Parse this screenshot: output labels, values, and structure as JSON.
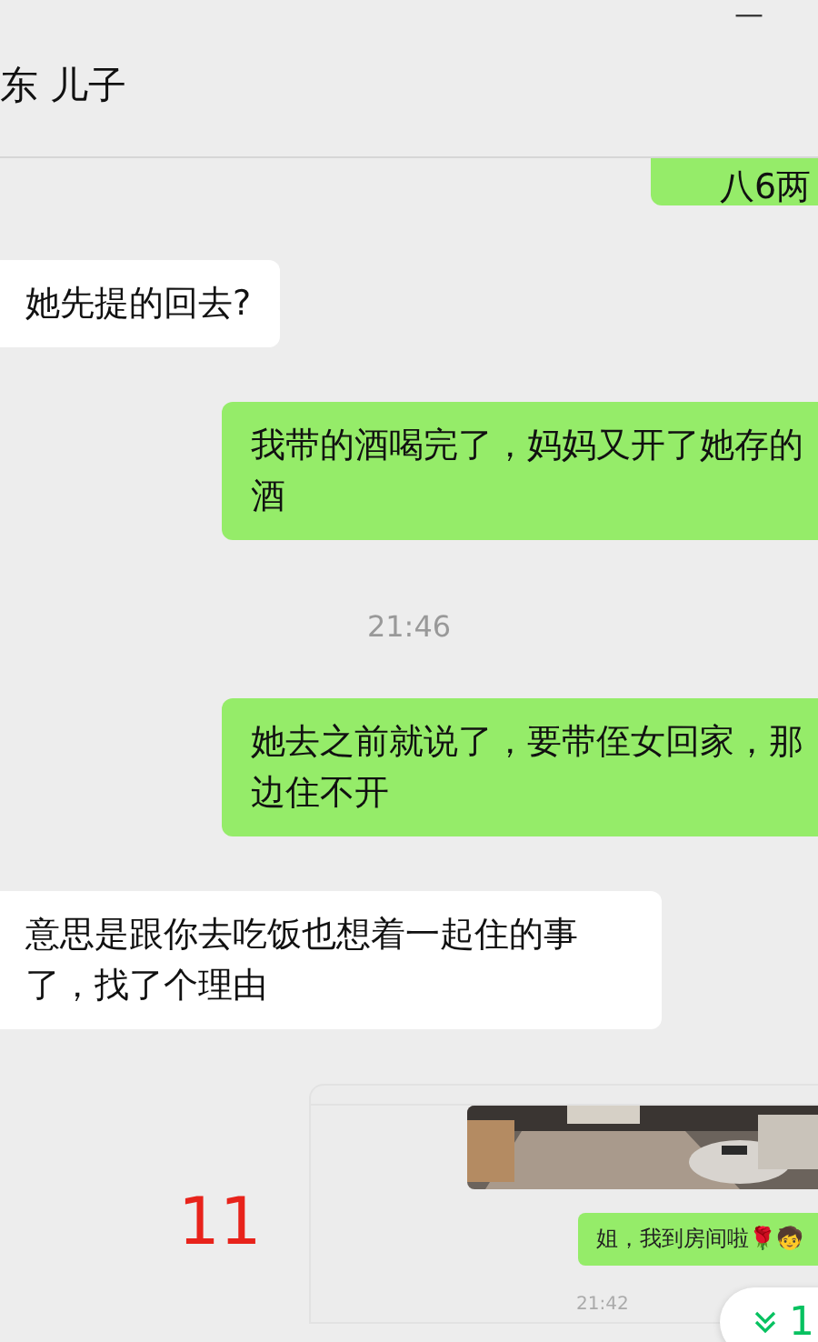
{
  "window": {
    "minimize": "—"
  },
  "header": {
    "title": "东 儿子"
  },
  "messages": [
    {
      "kind": "sent",
      "text": "八6两"
    },
    {
      "kind": "received",
      "text": "她先提的回去?"
    },
    {
      "kind": "sent",
      "text": "我带的酒喝完了，妈妈又开了她存的酒"
    },
    {
      "kind": "time",
      "text": "21:46"
    },
    {
      "kind": "sent",
      "text": "她去之前就说了，要带侄女回家，那边住不开"
    },
    {
      "kind": "received",
      "text": "意思是跟你去吃饭也想着一起住的事了，找了个理由"
    }
  ],
  "annotation": "11",
  "quoted_card": {
    "message": "姐，我到房间啦🌹🧒",
    "time": "21:42"
  },
  "new_messages_button": {
    "label": "1"
  }
}
